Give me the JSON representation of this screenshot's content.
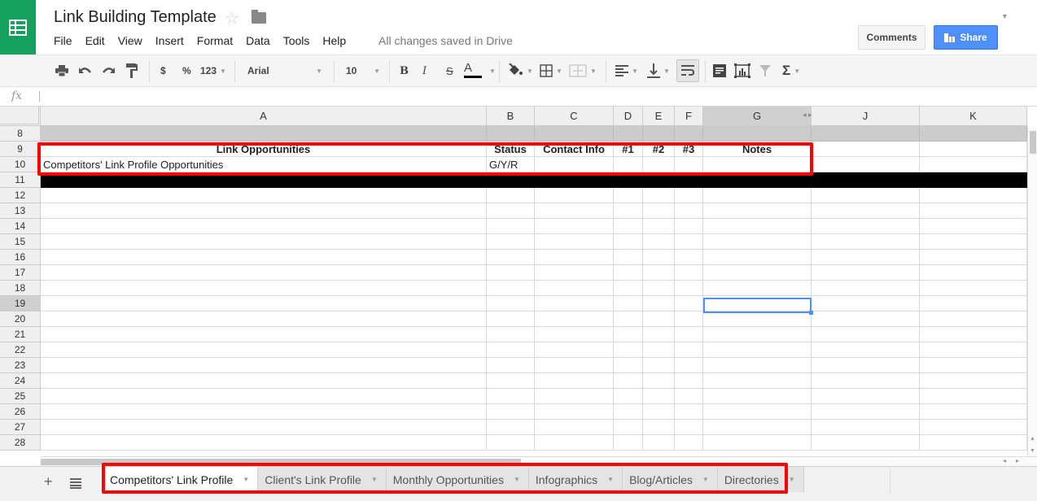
{
  "app": {
    "title": "Link Building Template",
    "save_status": "All changes saved in Drive",
    "menu": [
      "File",
      "Edit",
      "View",
      "Insert",
      "Format",
      "Data",
      "Tools",
      "Help"
    ],
    "comments_label": "Comments",
    "share_label": "Share",
    "share_color": "#4d90fe",
    "brand_color": "#16a05d"
  },
  "toolbar": {
    "currency": "$",
    "percent": "%",
    "number_format": "123",
    "font": "Arial",
    "font_size": "10",
    "bold": "B",
    "italic": "I",
    "strike": "S",
    "text_color": "A",
    "sum": "Σ"
  },
  "formula": {
    "fx_label": "fx",
    "value": ""
  },
  "columns": [
    "A",
    "B",
    "C",
    "D",
    "E",
    "F",
    "G",
    "J",
    "K"
  ],
  "rows": [
    "8",
    "9",
    "10",
    "11",
    "12",
    "13",
    "14",
    "15",
    "16",
    "17",
    "18",
    "19",
    "20",
    "21",
    "22",
    "23",
    "24",
    "25",
    "26",
    "27",
    "28"
  ],
  "selected_cell": "G19",
  "sheet": {
    "header_row": {
      "A": "Link Opportunities",
      "B": "Status",
      "C": "Contact Info",
      "D": "#1",
      "E": "#2",
      "F": "#3",
      "G": "Notes"
    },
    "row10": {
      "A": "Competitors' Link Profile Opportunities",
      "B": "G/Y/R"
    }
  },
  "tabs": [
    {
      "label": "Competitors' Link Profile",
      "active": true
    },
    {
      "label": "Client's Link Profile",
      "active": false
    },
    {
      "label": "Monthly Opportunities",
      "active": false
    },
    {
      "label": "Infographics",
      "active": false
    },
    {
      "label": "Blog/Articles",
      "active": false
    },
    {
      "label": "Directories",
      "active": false
    }
  ]
}
